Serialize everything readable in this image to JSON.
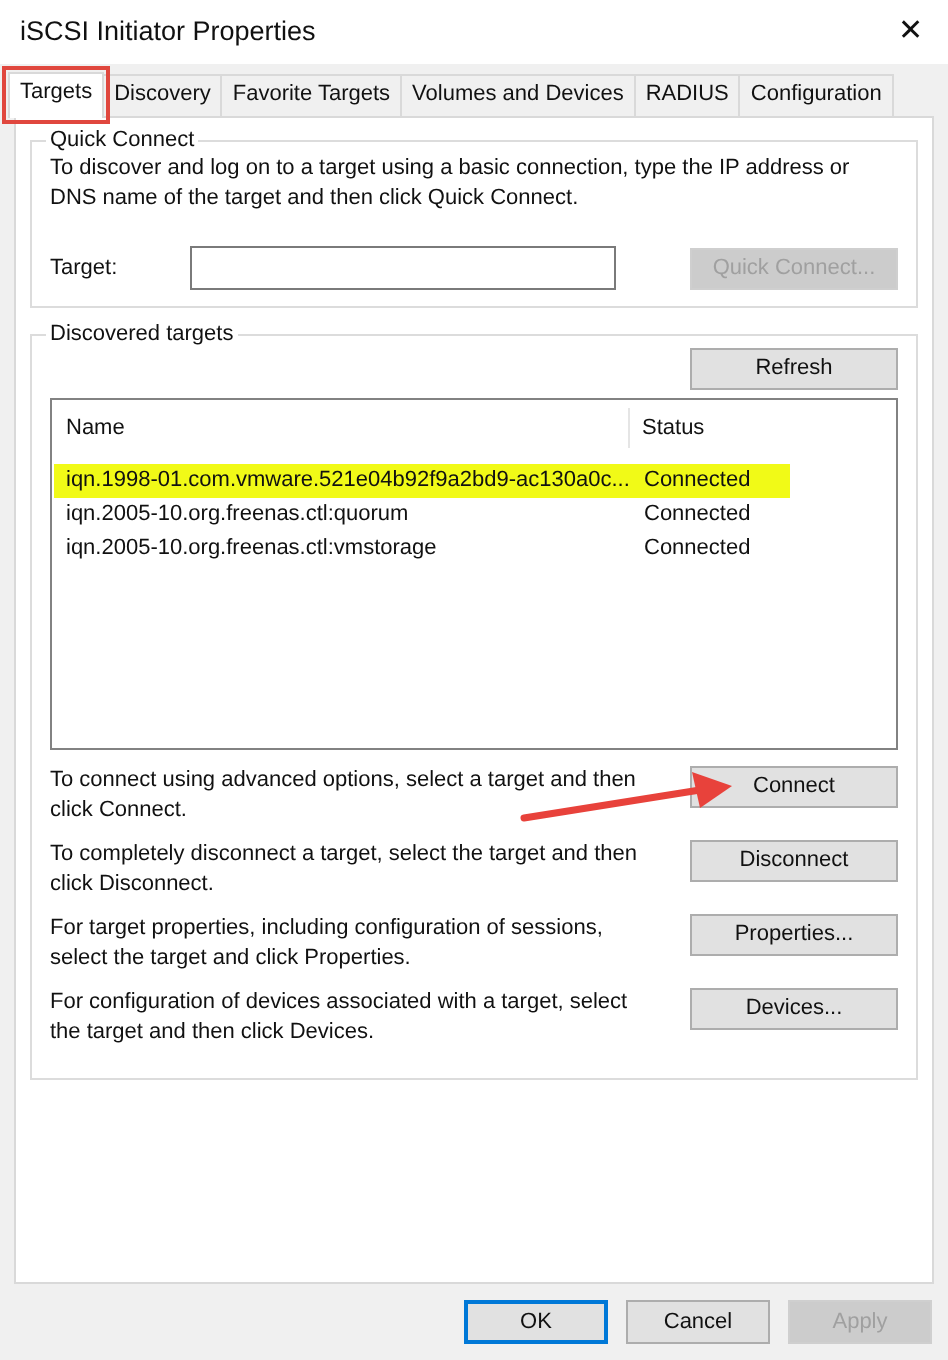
{
  "window": {
    "title": "iSCSI Initiator Properties",
    "close": "✕"
  },
  "tabs": [
    {
      "label": "Targets",
      "selected": true,
      "outlined": true
    },
    {
      "label": "Discovery",
      "selected": false,
      "outlined": false
    },
    {
      "label": "Favorite Targets",
      "selected": false,
      "outlined": false
    },
    {
      "label": "Volumes and Devices",
      "selected": false,
      "outlined": false
    },
    {
      "label": "RADIUS",
      "selected": false,
      "outlined": false
    },
    {
      "label": "Configuration",
      "selected": false,
      "outlined": false
    }
  ],
  "quick_connect": {
    "title": "Quick Connect",
    "description": "To discover and log on to a target using a basic connection, type the IP address or DNS name of the target and then click Quick Connect.",
    "target_label": "Target:",
    "button": {
      "label": "Quick Connect...",
      "disabled": true
    }
  },
  "discovered_targets": {
    "title": "Discovered targets",
    "refresh_button": "Refresh",
    "columns": [
      "Name",
      "Status"
    ],
    "rows": [
      {
        "name": "iqn.1998-01.com.vmware.521e04b92f9a2bd9-ac130a0c...",
        "status": "Connected",
        "highlighted": true
      },
      {
        "name": "iqn.2005-10.org.freenas.ctl:quorum",
        "status": "Connected",
        "highlighted": false
      },
      {
        "name": "iqn.2005-10.org.freenas.ctl:vmstorage",
        "status": "Connected",
        "highlighted": false
      }
    ]
  },
  "actions": [
    {
      "description": "To connect using advanced options, select a target and then click Connect.",
      "button": "Connect",
      "pointed": true
    },
    {
      "description": "To completely disconnect a target, select the target and then click Disconnect.",
      "button": "Disconnect",
      "pointed": false
    },
    {
      "description": "For target properties, including configuration of sessions, select the target and click Properties.",
      "button": "Properties...",
      "pointed": false
    },
    {
      "description": "For configuration of devices associated with a target, select the target and then click Devices.",
      "button": "Devices...",
      "pointed": false
    }
  ],
  "footer_buttons": [
    {
      "label": "OK",
      "default": true,
      "disabled": false
    },
    {
      "label": "Cancel",
      "default": false,
      "disabled": false
    },
    {
      "label": "Apply",
      "default": false,
      "disabled": true
    }
  ]
}
